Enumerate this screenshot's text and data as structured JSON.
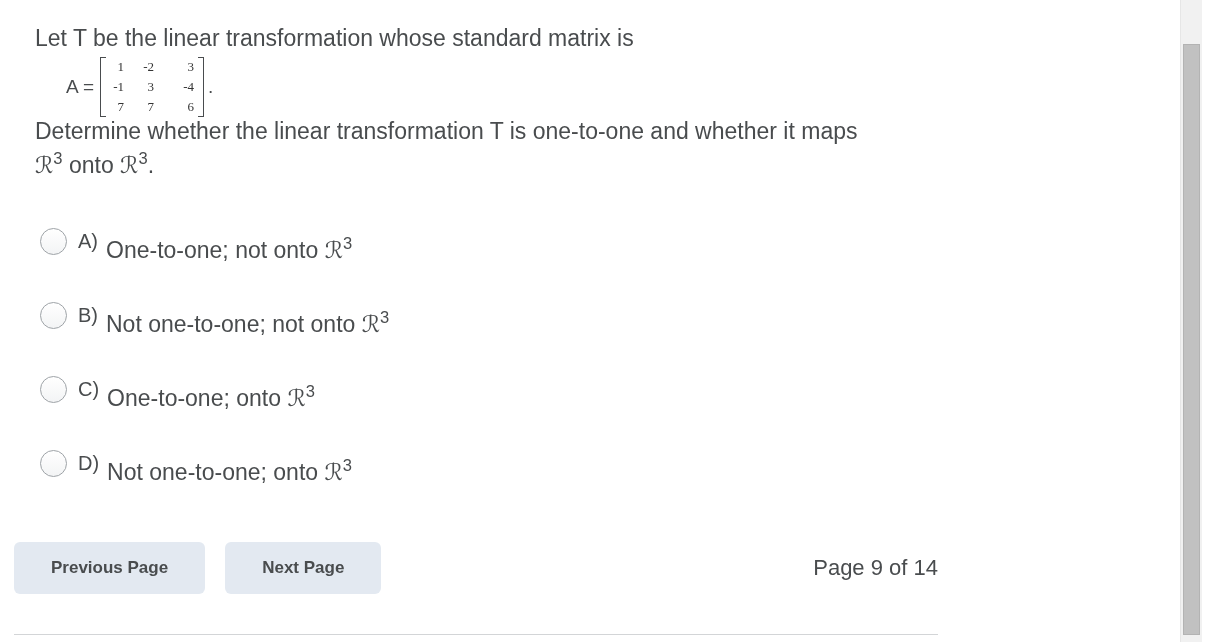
{
  "question": {
    "intro": "Let T be the linear transformation whose standard matrix is",
    "matrix": {
      "label": "A =",
      "rows": [
        [
          "1",
          "-2",
          "3"
        ],
        [
          "-1",
          "3",
          "-4"
        ],
        [
          "7",
          "7",
          "6"
        ]
      ],
      "trailing": "."
    },
    "prompt": "Determine whether the linear transformation T is one-to-one and whether it maps ℛ$^{3}$ onto ℛ$^{3}$."
  },
  "choices": [
    {
      "letter": "A)",
      "text": "One-to-one; not onto ℛ$^{3}$",
      "selected": false
    },
    {
      "letter": "B)",
      "text": "Not one-to-one; not onto ℛ$^{3}$",
      "selected": false
    },
    {
      "letter": "C)",
      "text": "One-to-one; onto ℛ$^{3}$",
      "selected": false
    },
    {
      "letter": "D)",
      "text": "Not one-to-one; onto ℛ$^{3}$",
      "selected": false
    }
  ],
  "navigation": {
    "buttons": [
      "Previous Page",
      "Next Page"
    ],
    "page_indicator": "Page 9 of 14"
  }
}
